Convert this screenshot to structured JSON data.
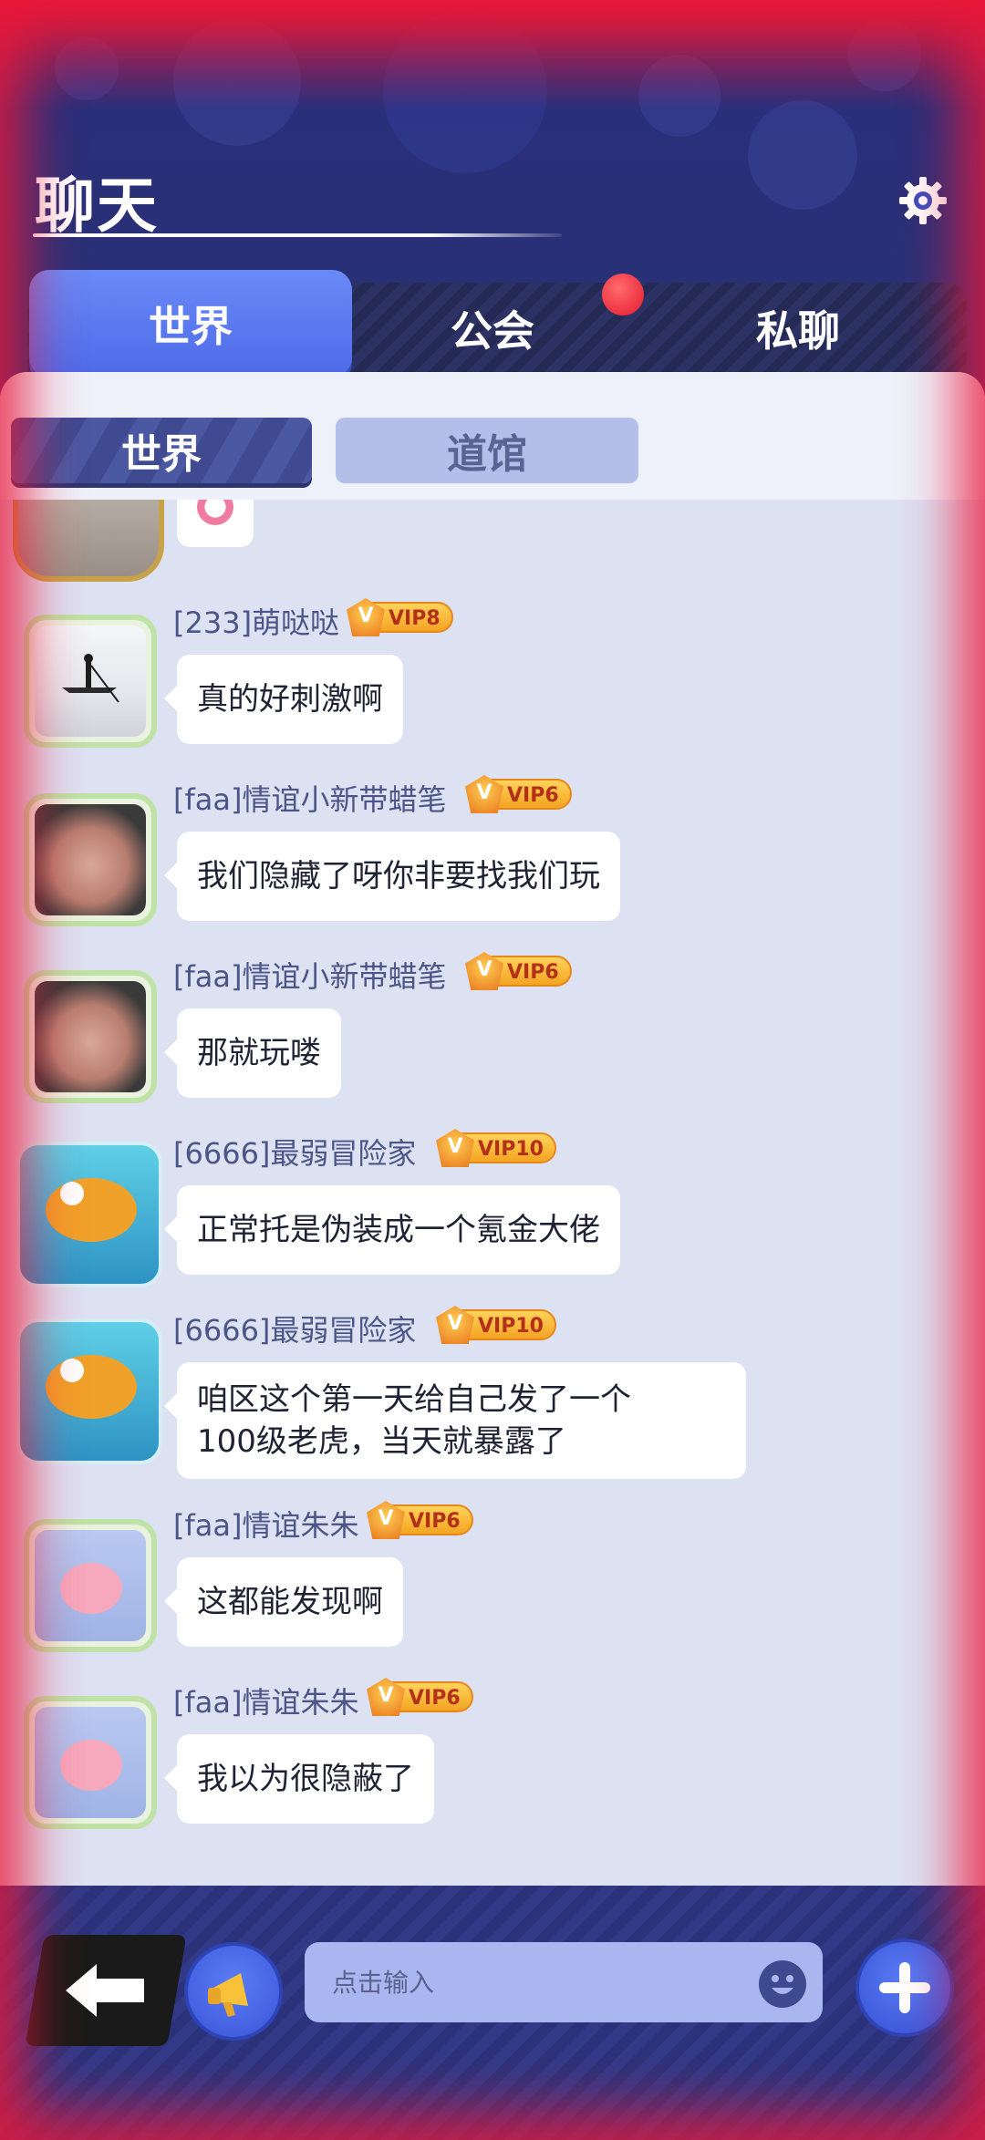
{
  "header": {
    "title": "聊天",
    "settings_icon": "gear-icon"
  },
  "tabs": [
    {
      "label": "世界",
      "active": true
    },
    {
      "label": "公会",
      "active": false,
      "has_notification": true
    },
    {
      "label": "私聊",
      "active": false
    }
  ],
  "subtabs": [
    {
      "label": "世界",
      "active": true
    },
    {
      "label": "道馆",
      "active": false
    }
  ],
  "messages": [
    {
      "name": "[233]萌哒哒",
      "vip": "VIP8",
      "text": "真的好刺激啊",
      "avatar": "boat-lake-avatar"
    },
    {
      "name": "[faa]情谊小新带蜡笔",
      "vip": "VIP6",
      "text": "我们隐藏了呀你非要找我们玩",
      "avatar": "plush-pig-avatar"
    },
    {
      "name": "[faa]情谊小新带蜡笔",
      "vip": "VIP6",
      "text": "那就玩喽",
      "avatar": "plush-pig-avatar"
    },
    {
      "name": "[6666]最弱冒险家",
      "vip": "VIP10",
      "text": "正常托是伪装成一个氪金大佬",
      "avatar": "duck-avatar"
    },
    {
      "name": "[6666]最弱冒险家",
      "vip": "VIP10",
      "text_line1": "咱区这个第一天给自己发了一个",
      "text_line2": "100级老虎，当天就暴露了",
      "avatar": "duck-avatar"
    },
    {
      "name": "[faa]情谊朱朱",
      "vip": "VIP6",
      "text": "这都能发现啊",
      "avatar": "pink-blob-avatar"
    },
    {
      "name": "[faa]情谊朱朱",
      "vip": "VIP6",
      "text": "我以为很隐蔽了",
      "avatar": "pink-blob-avatar"
    }
  ],
  "input": {
    "placeholder": "点击输入"
  },
  "colors": {
    "accent": "#4d6ae8",
    "panel": "#dde2f3",
    "vip_gold": "#f3a421",
    "notify_red": "#e4192f"
  }
}
